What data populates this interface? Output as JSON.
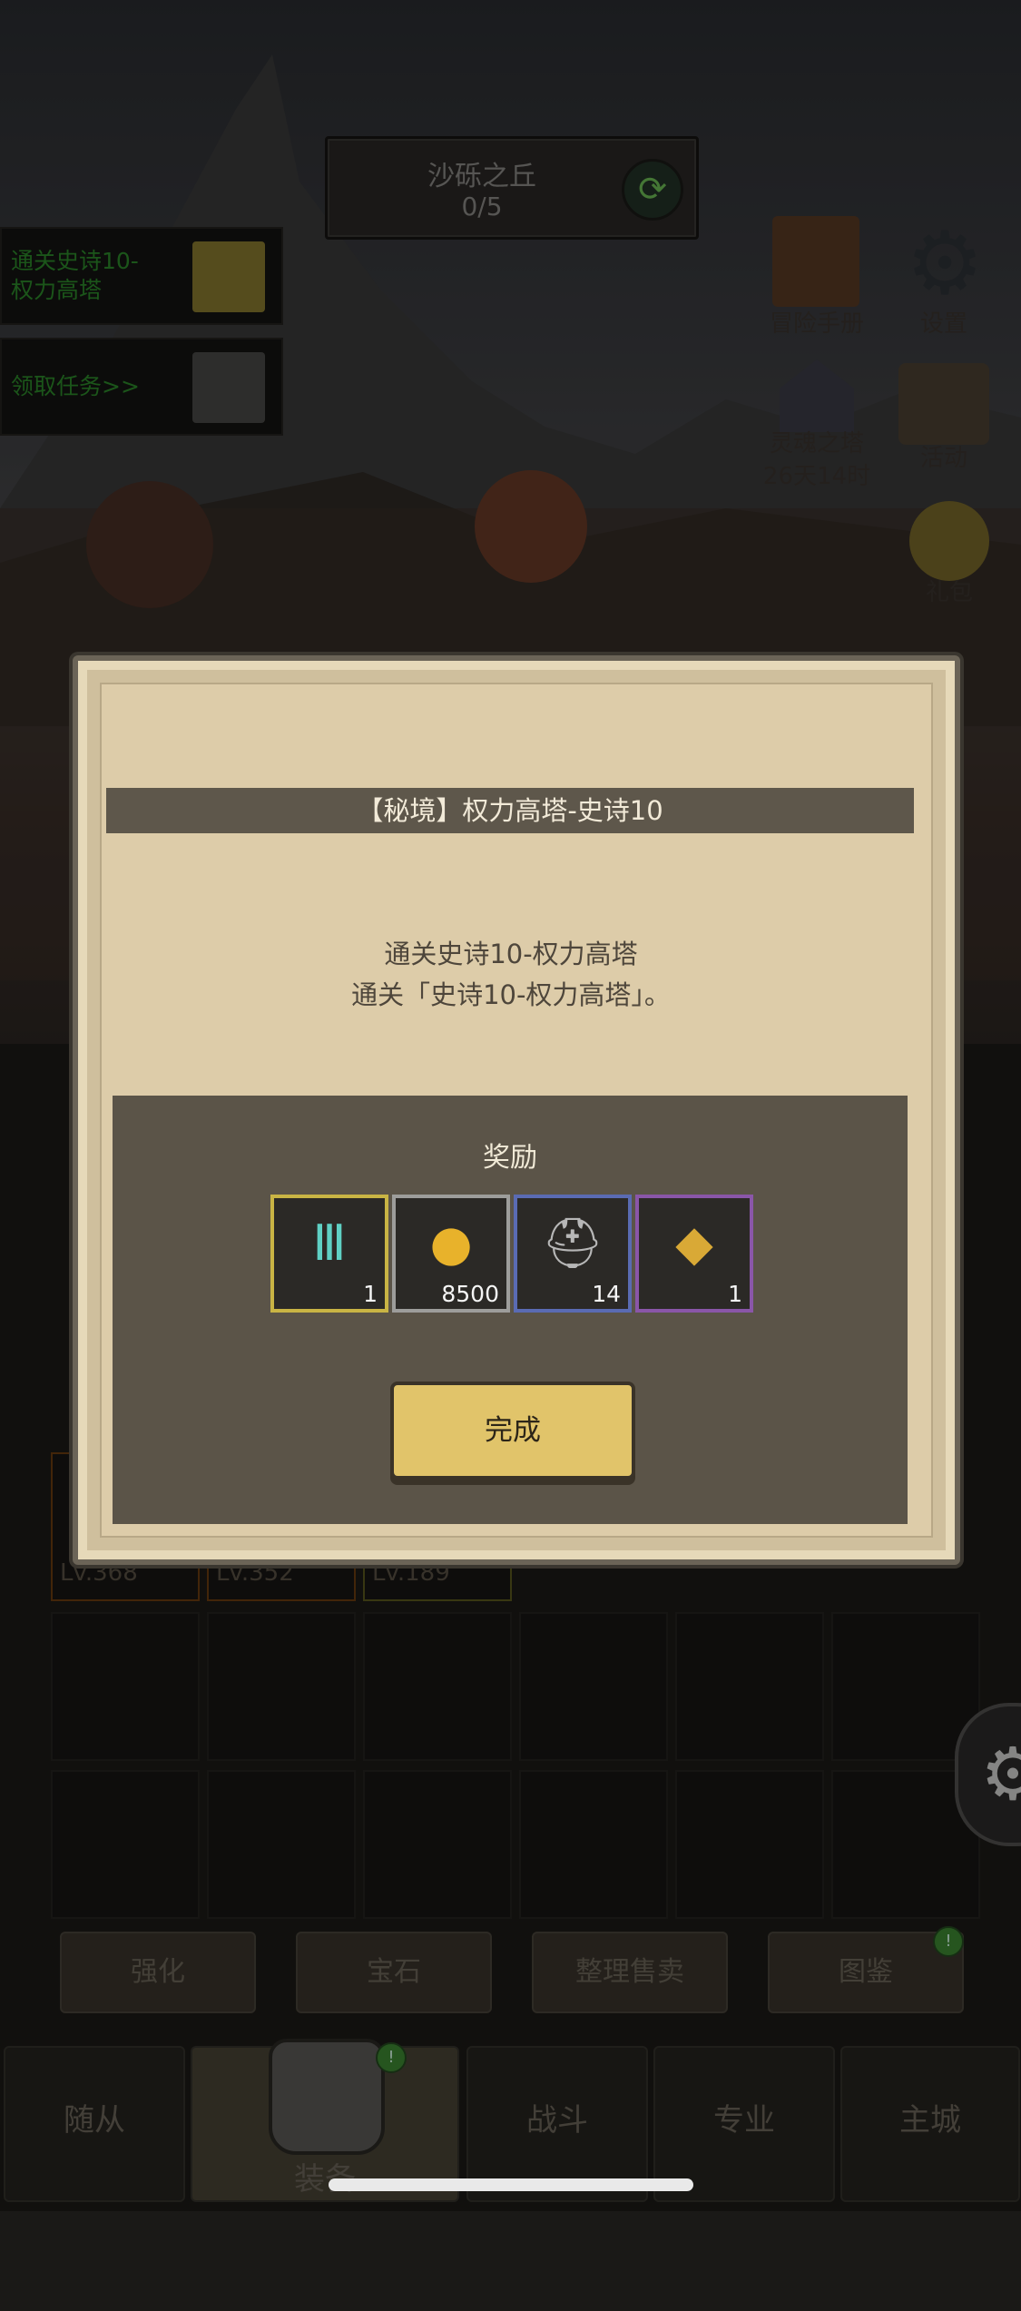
{
  "stage": {
    "name": "沙砾之丘",
    "progress": "0/5"
  },
  "quests": [
    {
      "text_line1": "通关史诗10-",
      "text_line2": "权力高塔"
    },
    {
      "text_line1": "领取任务>>",
      "text_line2": ""
    }
  ],
  "right_icons": {
    "adventure_manual": "冒险手册",
    "settings": "设置",
    "soul_tower_line1": "灵魂之塔",
    "soul_tower_line2": "26天14时",
    "activity": "活动",
    "gift_pack": "礼包"
  },
  "modal": {
    "title": "【秘境】权力高塔-史诗10",
    "description_line1": "通关史诗10-权力高塔",
    "description_line2": "通关「史诗10-权力高塔」。",
    "reward_title": "奖励",
    "rewards": [
      {
        "icon": "roman-three-token-icon",
        "count": "1",
        "frame_color": "#c9b444"
      },
      {
        "icon": "gold-coin-icon",
        "count": "8500",
        "frame_color": "#9d9d9b"
      },
      {
        "icon": "horned-helmet-icon",
        "count": "14",
        "frame_color": "#5a6bb3"
      },
      {
        "icon": "ore-crystal-icon",
        "count": "1",
        "frame_color": "#8a56a8"
      }
    ],
    "complete_button": "完成"
  },
  "equipment_levels": [
    "Lv.368",
    "Lv.352",
    "Lv.189"
  ],
  "sub_buttons": [
    "强化",
    "宝石",
    "整理售卖",
    "图鉴"
  ],
  "tabs": [
    "随从",
    "装备",
    "战斗",
    "专业",
    "主城"
  ],
  "colors": {
    "accent_gold": "#e1c46a",
    "quest_green": "#2d8a2a",
    "modal_parchment": "#ddcca9"
  }
}
